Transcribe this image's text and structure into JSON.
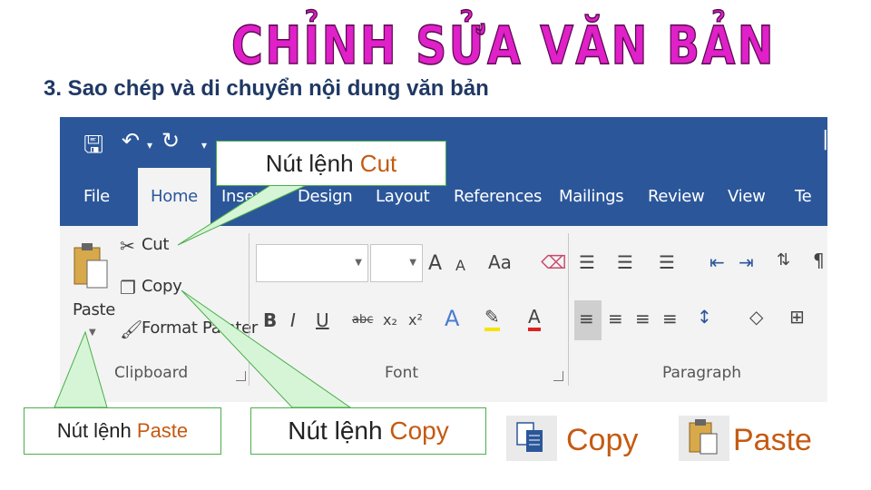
{
  "title": "CHỈNH SỬA VĂN BẢN",
  "subtitle": "3. Sao chép và di chuyển nội dung văn bản",
  "ribbon": {
    "tabs": [
      "File",
      "Home",
      "Insert",
      "Design",
      "Layout",
      "References",
      "Mailings",
      "Review",
      "View",
      "Te"
    ],
    "active_tab": "Home",
    "clipboard": {
      "paste_label": "Paste",
      "cut_label": "Cut",
      "copy_label": "Copy",
      "format_painter_label": "Format Painter",
      "group_label": "Clipboard"
    },
    "font": {
      "group_label": "Font",
      "bold": "B",
      "italic": "I",
      "underline": "U",
      "strike": "abc",
      "subscript": "x₂",
      "superscript": "x²",
      "font_color_letter": "A",
      "grow": "A",
      "shrink": "A",
      "change_case": "Aa"
    },
    "paragraph": {
      "group_label": "Paragraph",
      "pilcrow": "¶"
    }
  },
  "callouts": {
    "cut": {
      "prefix": "Nút lệnh ",
      "name": "Cut"
    },
    "paste": {
      "prefix": "Nút lệnh ",
      "name": "Paste"
    },
    "copy": {
      "prefix": "Nút lệnh ",
      "name": "Copy"
    }
  },
  "legend": {
    "copy_label": "Copy",
    "paste_label": "Paste"
  },
  "colors": {
    "title_magenta": "#e020c8",
    "subtitle_navy": "#1f3864",
    "ribbon_blue": "#2b579a",
    "accent_orange": "#c55a11",
    "callout_green": "#4cae4c"
  }
}
